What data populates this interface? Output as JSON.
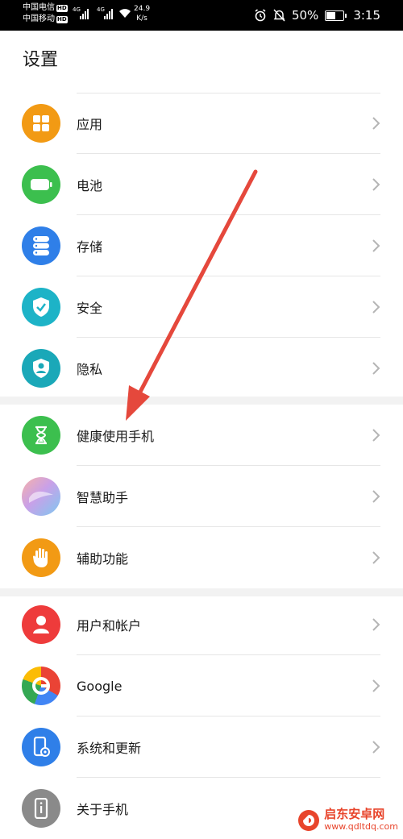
{
  "status_bar": {
    "carrier1": "中国电信",
    "carrier2": "中国移动",
    "hd": "HD",
    "net_tag": "4G",
    "speed_value": "24.9",
    "speed_unit": "K/s",
    "battery_percent": "50%",
    "time": "3:15",
    "battery_level": 0.5
  },
  "page_title": "设置",
  "groups": [
    [
      {
        "label": "应用",
        "icon": "apps-icon",
        "color": "#f29a14"
      },
      {
        "label": "电池",
        "icon": "battery-icon",
        "color": "#3cbf4e"
      },
      {
        "label": "存储",
        "icon": "storage-icon",
        "color": "#2f7fe8"
      },
      {
        "label": "安全",
        "icon": "security-shield-icon",
        "color": "#1db3c7"
      },
      {
        "label": "隐私",
        "icon": "privacy-icon",
        "color": "#1aa8b8"
      }
    ],
    [
      {
        "label": "健康使用手机",
        "icon": "hourglass-icon",
        "color": "#3cbf4e"
      },
      {
        "label": "智慧助手",
        "icon": "smart-assistant-icon",
        "color": "#c9a0e8"
      },
      {
        "label": "辅助功能",
        "icon": "hand-icon",
        "color": "#f29a14"
      }
    ],
    [
      {
        "label": "用户和帐户",
        "icon": "user-icon",
        "color": "#ee3b3b"
      },
      {
        "label": "Google",
        "icon": "google-icon",
        "color": "#ffffff"
      },
      {
        "label": "系统和更新",
        "icon": "system-update-icon",
        "color": "#2f7fe8"
      },
      {
        "label": "关于手机",
        "icon": "about-phone-icon",
        "color": "#8a8a8a"
      }
    ]
  ],
  "watermark": {
    "title": "启东安卓网",
    "url": "www.qdltdq.com"
  },
  "annotation_color": "#e5483c"
}
